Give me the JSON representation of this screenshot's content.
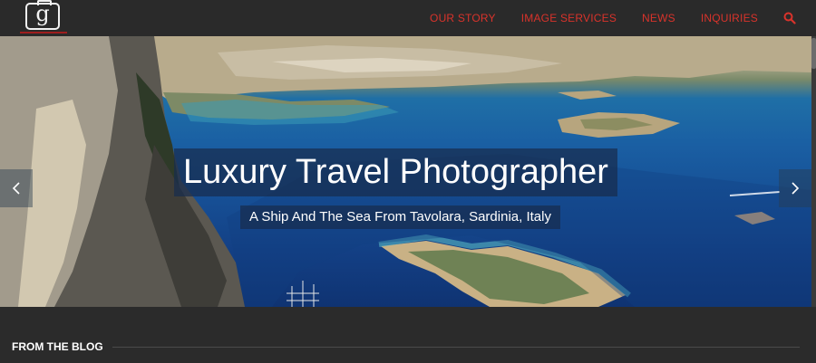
{
  "brand": {
    "logo_letter": "g"
  },
  "nav": {
    "items": [
      {
        "label": "OUR STORY"
      },
      {
        "label": "IMAGE SERVICES"
      },
      {
        "label": "NEWS"
      },
      {
        "label": "INQUIRIES"
      }
    ],
    "search_icon": "search-icon",
    "color": "#d9332b"
  },
  "hero": {
    "title": "Luxury Travel Photographer",
    "subtitle": "A Ship And The Sea From Tavolara, Sardinia, Italy",
    "prev_icon": "chevron-left-icon",
    "next_icon": "chevron-right-icon"
  },
  "blog": {
    "heading": "FROM THE BLOG"
  }
}
